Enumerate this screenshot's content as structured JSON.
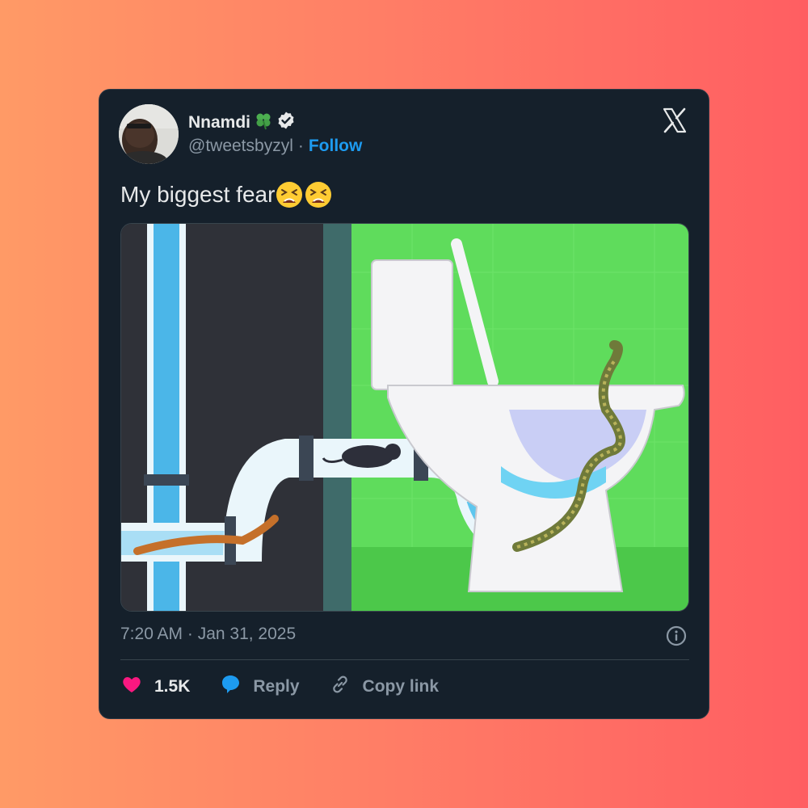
{
  "tweet": {
    "author": {
      "name": "Nnamdi",
      "name_emoji_icon": "four-leaf-clover-icon",
      "verified_icon": "verified-badge-icon",
      "handle": "@tweetsbyzyl",
      "separator": "·",
      "follow_label": "Follow"
    },
    "platform_icon": "x-logo-icon",
    "text": "My biggest fear",
    "text_emojis": [
      "tired-face-icon",
      "tired-face-icon"
    ],
    "timestamp": "7:20 AM · Jan 31, 2025",
    "info_icon": "info-icon",
    "actions": {
      "like_count": "1.5K",
      "reply_label": "Reply",
      "copy_link_label": "Copy link"
    }
  },
  "colors": {
    "card_bg": "#15202b",
    "accent_blue": "#1d9bf0",
    "like_pink": "#f91880",
    "muted_text": "#8b98a5"
  }
}
